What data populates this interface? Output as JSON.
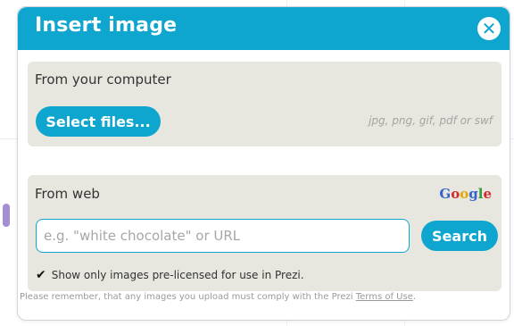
{
  "dialog": {
    "title": "Insert image",
    "close_icon": "close-icon",
    "colors": {
      "accent": "#0ea6cf",
      "panel": "#e7e6df"
    }
  },
  "computer": {
    "label": "From your computer",
    "select_button": "Select files...",
    "file_types": "jpg, png, gif, pdf or swf"
  },
  "web": {
    "label": "From web",
    "provider": {
      "g1": "G",
      "o1": "o",
      "o2": "o",
      "g2": "g",
      "l": "l",
      "e": "e"
    },
    "search_placeholder": "e.g. \"white chocolate\" or URL",
    "search_value": "",
    "search_button": "Search",
    "checkbox_checked": true,
    "checkbox_label": "Show only images pre-licensed for use in Prezi."
  },
  "footer": {
    "notice": "Please remember, that any images you upload must comply with the Prezi ",
    "terms_link": "Terms of Use",
    "terms_suffix": "."
  }
}
